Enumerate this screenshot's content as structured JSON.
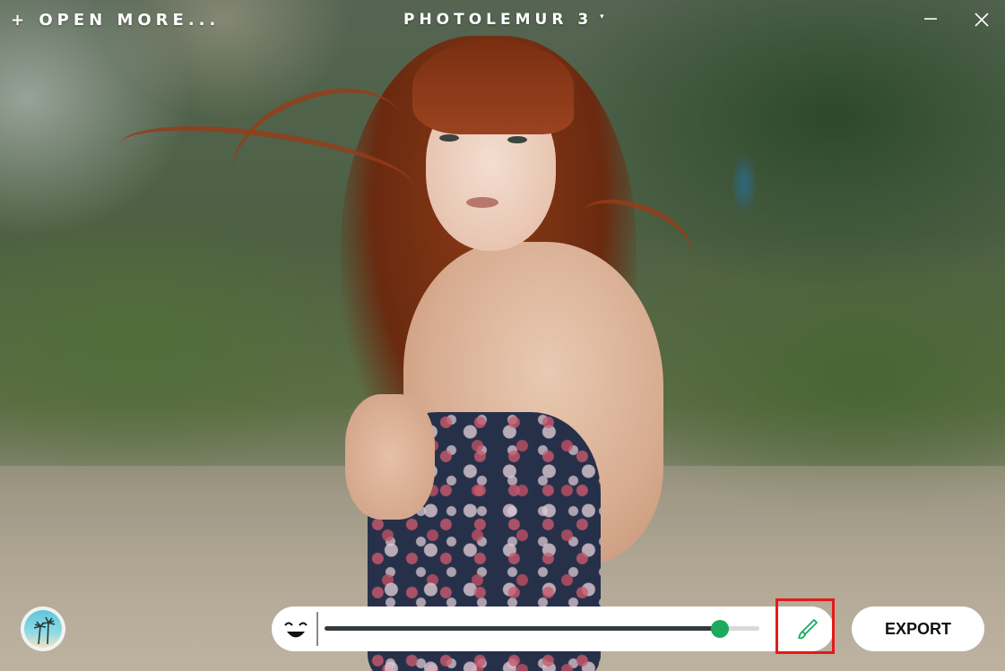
{
  "window": {
    "open_more_label": "+ OPEN MORE...",
    "title": "PHOTOLEMUR 3",
    "title_caret": "▾",
    "minimize_icon": "minimize-icon",
    "close_icon": "close-icon"
  },
  "canvas": {
    "image_description_icon": "photo-preview"
  },
  "bottom_bar": {
    "thumbnail_icon": "palm-tree-thumbnail-icon",
    "face_icon": "face-enhance-icon",
    "enhancement_slider": {
      "value_fraction": 0.91
    },
    "brush_icon": "brush-icon",
    "export_label": "EXPORT"
  },
  "colors": {
    "accent_green": "#1aab5d",
    "highlight_red": "#e31a1a",
    "slider_track": "#d9d9d9",
    "slider_fill": "#333a3e"
  }
}
